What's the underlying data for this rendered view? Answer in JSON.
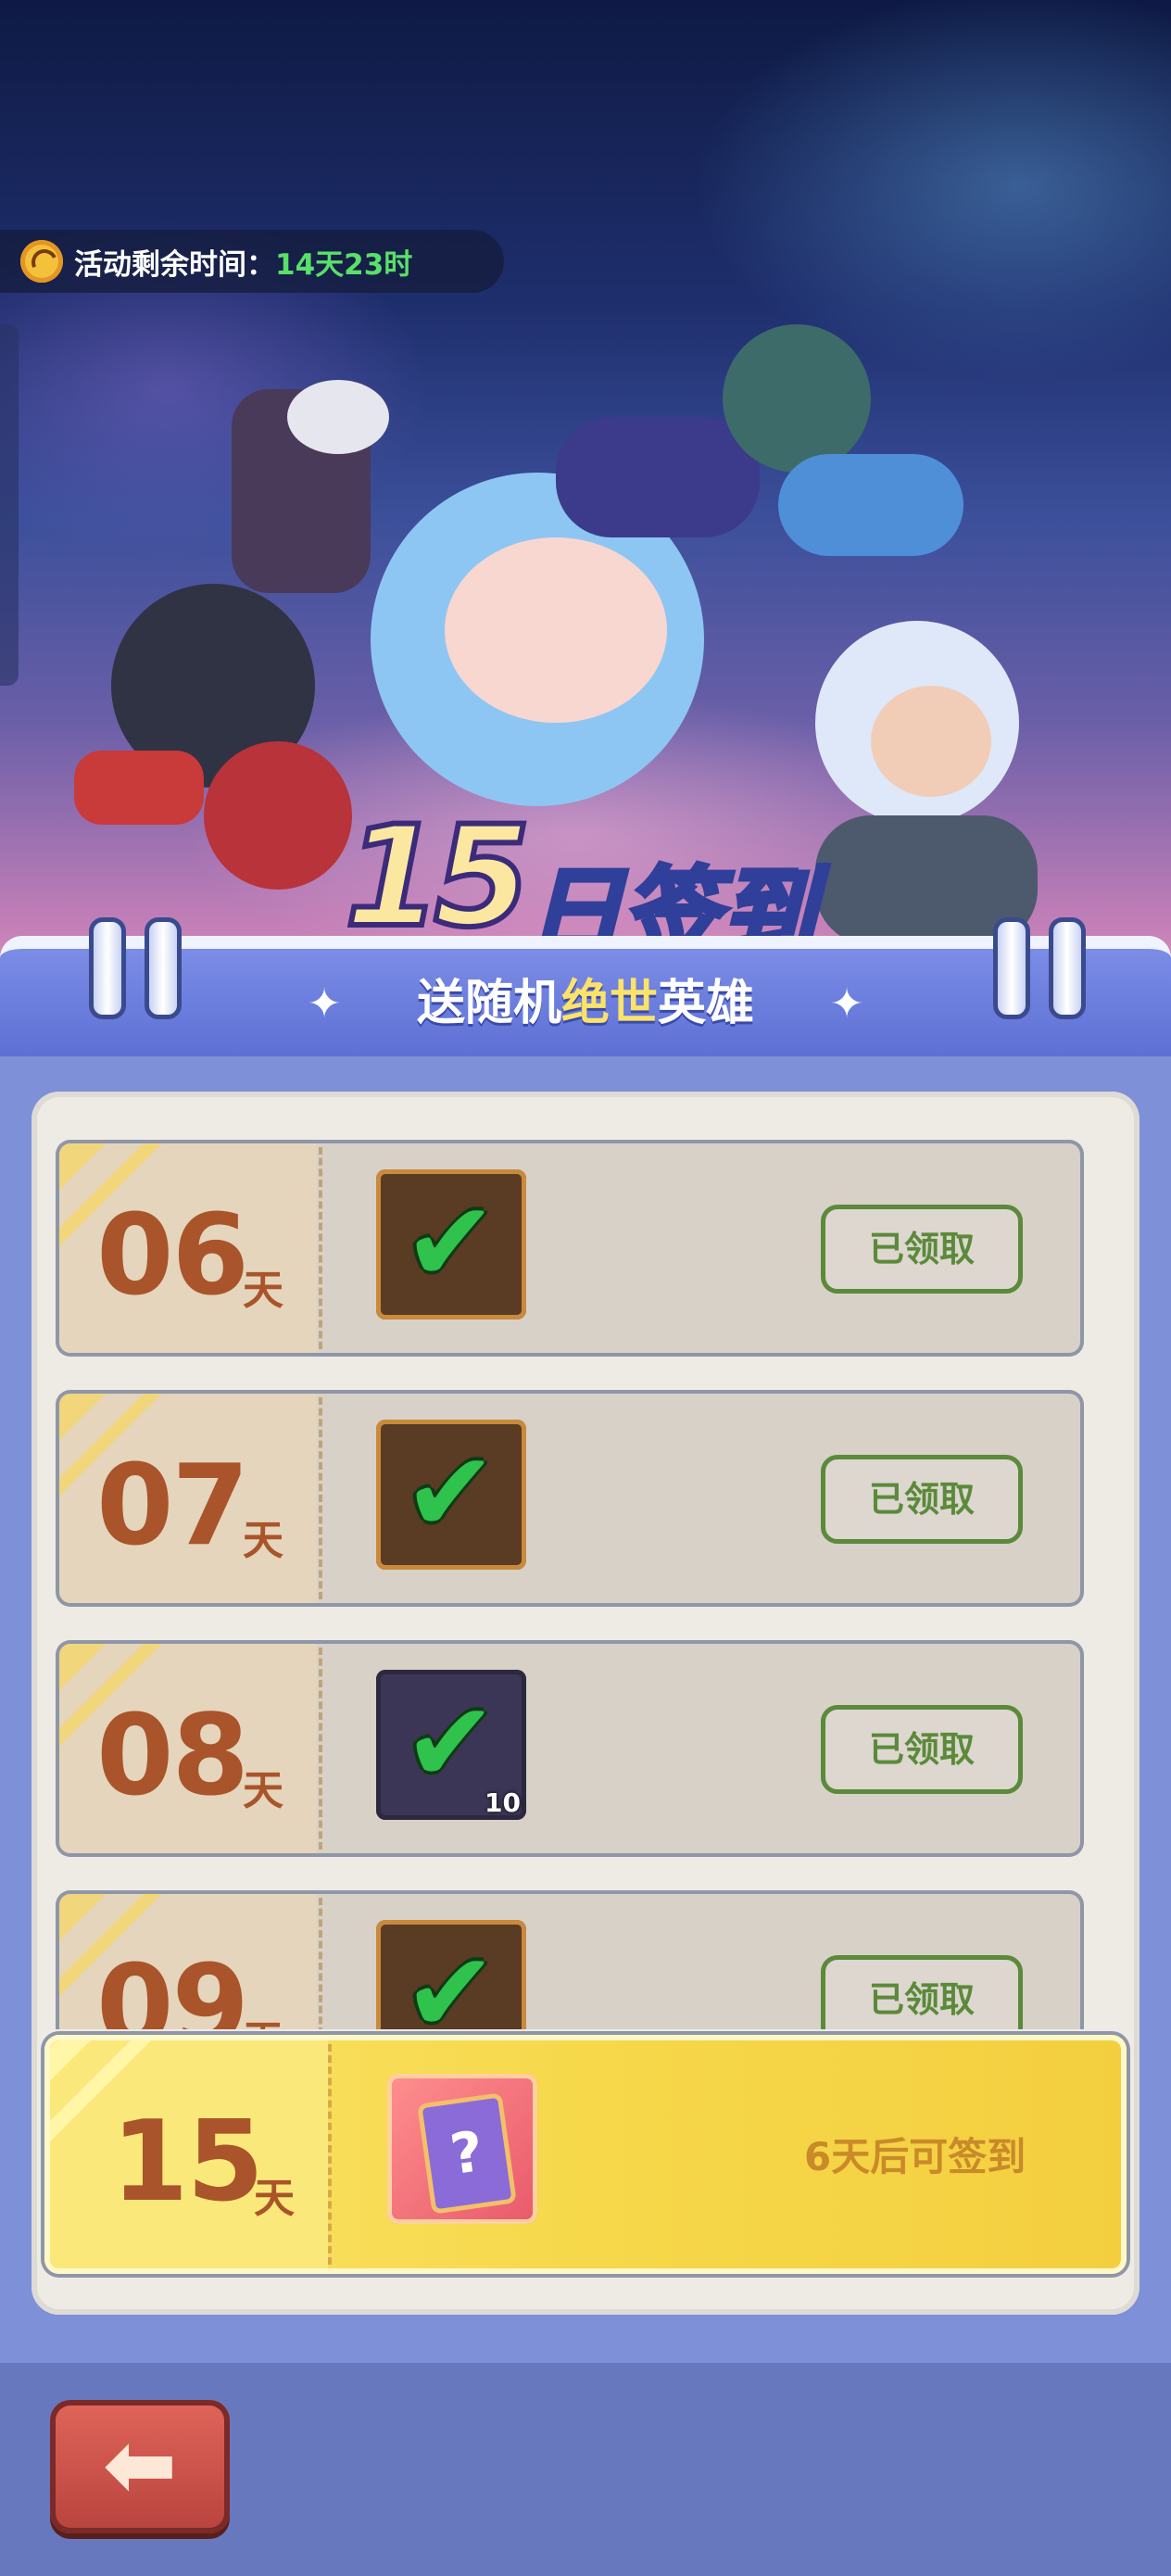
{
  "timer": {
    "label": "活动剩余时间：",
    "value": "14天23时"
  },
  "banner": {
    "title_num": "15",
    "title_text": "日签到",
    "subtitle_pre": "送随机",
    "subtitle_hl": "绝世",
    "subtitle_post": "英雄"
  },
  "rows": [
    {
      "day": "06",
      "unit": "天",
      "status": "已领取"
    },
    {
      "day": "07",
      "unit": "天",
      "status": "已领取"
    },
    {
      "day": "08",
      "unit": "天",
      "status": "已领取",
      "qty": "10"
    },
    {
      "day": "09",
      "unit": "天",
      "status": "已领取"
    }
  ],
  "final": {
    "day": "15",
    "unit": "天",
    "status": "6天后可签到"
  },
  "icons": {
    "clock": "clock-icon",
    "check": "checkmark-icon",
    "back": "back-arrow-icon",
    "mystery": "mystery-card-icon"
  },
  "colors": {
    "accent_green": "#59e06a",
    "day_brown": "#a9542a",
    "claimed_green": "#5b8a3a",
    "gold": "#f6d84a"
  }
}
